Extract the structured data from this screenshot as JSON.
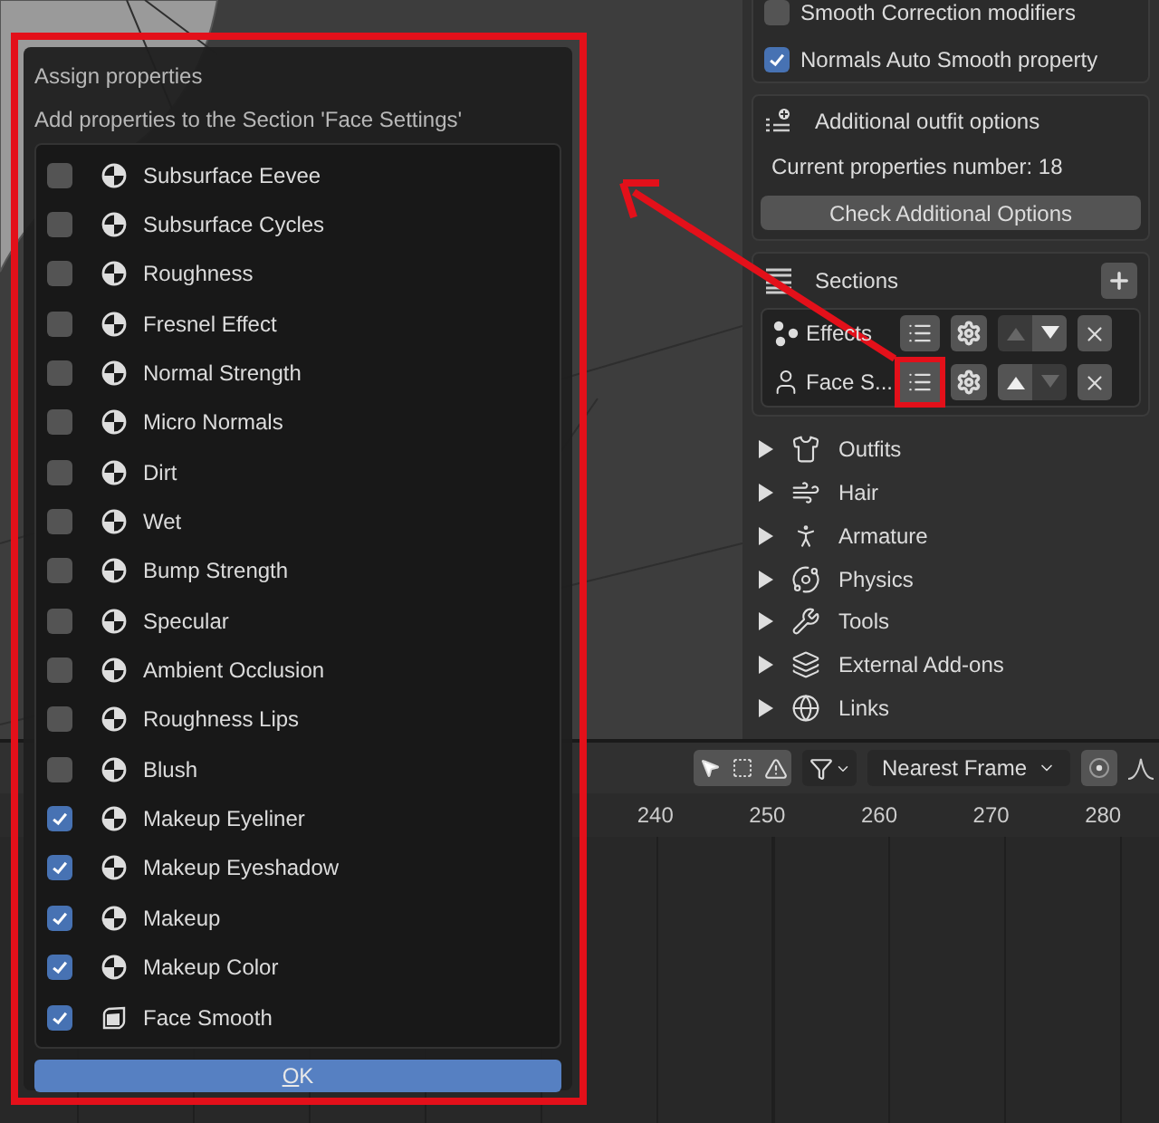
{
  "dialog": {
    "title": "Assign properties",
    "subtitle": "Add properties to the Section 'Face Settings'",
    "items": [
      {
        "label": "Subsurface Eevee",
        "checked": false,
        "kind": "shader"
      },
      {
        "label": "Subsurface Cycles",
        "checked": false,
        "kind": "shader"
      },
      {
        "label": "Roughness",
        "checked": false,
        "kind": "shader"
      },
      {
        "label": "Fresnel Effect",
        "checked": false,
        "kind": "shader"
      },
      {
        "label": "Normal Strength",
        "checked": false,
        "kind": "shader"
      },
      {
        "label": "Micro Normals",
        "checked": false,
        "kind": "shader"
      },
      {
        "label": "Dirt",
        "checked": false,
        "kind": "shader"
      },
      {
        "label": "Wet",
        "checked": false,
        "kind": "shader"
      },
      {
        "label": "Bump Strength",
        "checked": false,
        "kind": "shader"
      },
      {
        "label": "Specular",
        "checked": false,
        "kind": "shader"
      },
      {
        "label": "Ambient Occlusion",
        "checked": false,
        "kind": "shader"
      },
      {
        "label": "Roughness Lips",
        "checked": false,
        "kind": "shader"
      },
      {
        "label": "Blush",
        "checked": false,
        "kind": "shader"
      },
      {
        "label": "Makeup Eyeliner",
        "checked": true,
        "kind": "shader"
      },
      {
        "label": "Makeup Eyeshadow",
        "checked": true,
        "kind": "shader"
      },
      {
        "label": "Makeup",
        "checked": true,
        "kind": "shader"
      },
      {
        "label": "Makeup Color",
        "checked": true,
        "kind": "shader"
      },
      {
        "label": "Face Smooth",
        "checked": true,
        "kind": "modifier"
      }
    ],
    "ok_button": "OK"
  },
  "options": [
    {
      "label": "Smooth Correction modifiers",
      "checked": false
    },
    {
      "label": "Normals Auto Smooth property",
      "checked": true
    }
  ],
  "outfit_options": {
    "title": "Additional outfit options",
    "count": "Current properties number: 18",
    "button": "Check Additional Options"
  },
  "sections": {
    "title": "Sections",
    "rows": [
      {
        "label": "Effects",
        "kind": "dots",
        "up_enabled": false,
        "down_enabled": true,
        "highlighted": false
      },
      {
        "label": "Face S...",
        "kind": "person",
        "up_enabled": true,
        "down_enabled": false,
        "highlighted": true
      }
    ]
  },
  "panels": [
    {
      "label": "Outfits",
      "kind": "shirt"
    },
    {
      "label": "Hair",
      "kind": "hair"
    },
    {
      "label": "Armature",
      "kind": "armature"
    },
    {
      "label": "Physics",
      "kind": "physics"
    },
    {
      "label": "Tools",
      "kind": "tools"
    },
    {
      "label": "External Add-ons",
      "kind": "addons"
    },
    {
      "label": "Links",
      "kind": "links"
    }
  ],
  "timeline": {
    "snap_mode": "Nearest Frame",
    "ruler": [
      "240",
      "250",
      "260",
      "270",
      "280"
    ]
  }
}
